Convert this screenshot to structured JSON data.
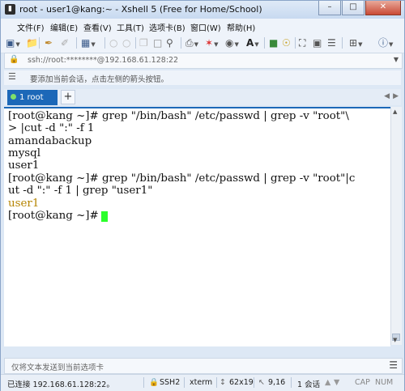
{
  "window": {
    "title": "root - user1@kang:~ - Xshell 5 (Free for Home/School)",
    "minimize": "–",
    "maximize": "□",
    "close": "✕"
  },
  "menu": [
    "文件(F)",
    "编辑(E)",
    "查看(V)",
    "工具(T)",
    "选项卡(B)",
    "窗口(W)",
    "帮助(H)"
  ],
  "toolbar_icons": [
    "new-session-icon",
    "open-folder-icon",
    "edit-icon",
    "paint-icon",
    "properties-icon",
    "reconnect-icon",
    "disconnect-icon",
    "copy-icon",
    "paste-icon",
    "find-icon",
    "print-icon",
    "transfer-icon",
    "globe-icon",
    "font-icon",
    "color-icon",
    "key-icon",
    "fullscreen-icon",
    "lock-icon",
    "script-icon",
    "add-icon",
    "help-icon"
  ],
  "address": {
    "text": "ssh://root:********@192.168.61.128:22"
  },
  "hint": {
    "text": "要添加当前会话，点击左侧的箭头按钮。"
  },
  "tabs": [
    {
      "label": "1 root",
      "active": true
    }
  ],
  "tab_add": "+",
  "terminal": {
    "lines": [
      "[root@kang ~]# grep \"/bin/bash\" /etc/passwd | grep -v \"root\"\\",
      "> |cut -d \":\" -f 1",
      "amandabackup",
      "mysql",
      "user1",
      "[root@kang ~]# grep \"/bin/bash\" /etc/passwd | grep -v \"root\"|c",
      "ut -d \":\" -f 1 | grep \"user1\"",
      "user1",
      "[root@kang ~]# "
    ],
    "highlight_color": "#b58400",
    "cursor_color": "#2bff2b"
  },
  "compose": {
    "placeholder": "仅将文本发送到当前选项卡"
  },
  "status": {
    "connection": "已连接 192.168.61.128:22。",
    "protocol": "SSH2",
    "terminal_type": "xterm",
    "size": "62x19",
    "cursor_pos": "9,16",
    "sessions": "1 会话",
    "caps": "CAP",
    "num": "NUM"
  }
}
